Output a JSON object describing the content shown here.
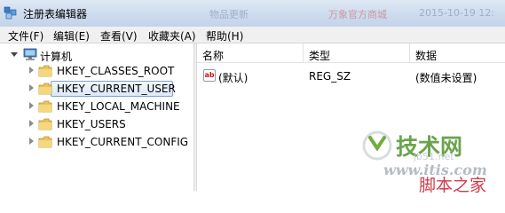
{
  "window": {
    "title": "注册表编辑器",
    "bg_ghost_texts": [
      "物品更新",
      "万象官方商城",
      "2015-10-19 12:"
    ]
  },
  "menu": [
    "文件(F)",
    "编辑(E)",
    "查看(V)",
    "收藏夹(A)",
    "帮助(H)"
  ],
  "tree": {
    "root": "计算机",
    "items": [
      {
        "label": "HKEY_CLASSES_ROOT",
        "selected": false
      },
      {
        "label": "HKEY_CURRENT_USER",
        "selected": true
      },
      {
        "label": "HKEY_LOCAL_MACHINE",
        "selected": false
      },
      {
        "label": "HKEY_USERS",
        "selected": false
      },
      {
        "label": "HKEY_CURRENT_CONFIG",
        "selected": false
      }
    ]
  },
  "list": {
    "headers": [
      "名称",
      "类型",
      "数据"
    ],
    "rows": [
      {
        "name": "(默认)",
        "type": "REG_SZ",
        "data": "(数值未设置)",
        "icon": "string-value-icon"
      }
    ]
  },
  "watermark": {
    "brand": "技术网",
    "site_partial": "jb51.net",
    "url": "www.itis.com",
    "footer": "脚本之家"
  },
  "colors": {
    "titlebar": "#cfdcee",
    "selection_border": "#7da2ce",
    "folder": "#e9c45a",
    "watermark_green": "#5a9a3a",
    "watermark_red": "#cf3c4a"
  }
}
